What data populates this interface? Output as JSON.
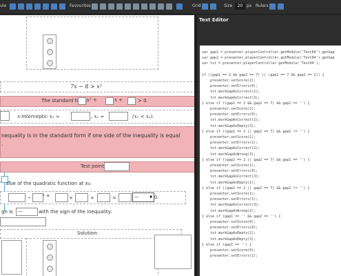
{
  "toolbar": {
    "favourites_label": "Favourites",
    "grid_label": "Grid",
    "size_label": "Size",
    "size_value": "20",
    "size_unit": "px",
    "rulers_label": "Rulers",
    "left_fragment": "ule"
  },
  "canvas": {
    "equation": "7x − 8 > x²",
    "standard_form_label": "The standard form:",
    "standard_form_x2": "x² +",
    "standard_form_x": "x +",
    "standard_form_end": "> 0.",
    "intercepts_label": "x-intercepts: x₁ ≈",
    "intercepts_x2": ", x₂ ≈",
    "intercepts_cond": "(x₁ < x₂).",
    "hint_line1": "nequality is in the standard form if one side of the inequality is equal",
    "hint_line2": ".",
    "test_point_label": "Test point:",
    "value_label": "alue of the quadratic function at x₀:",
    "calc_minus": "−",
    "calc_sq": "²  +",
    "calc_times": "×",
    "calc_plus": "+",
    "calc_eq": "=",
    "select_value": "---",
    "select_end": "0.",
    "sign_prefix": "gn is",
    "sign_select": "---",
    "sign_suffix": "with the sign of the inequality:",
    "solution_label": "Solution:"
  },
  "editor": {
    "title": "Text Editor",
    "lines": [
      "var gap1 = presenter.playerController.getModule('Text04').getGap",
      "var gap2 = presenter.playerController.getModule('Text04').getGap",
      "var txt = presenter.playerController.getModule('Text04');",
      "",
      "if ((gap1 == 2 && gap2 == 7) || (gap1 == 7 && gap2 == 2)) {",
      "    presenter.setScore(2);",
      "    presenter.setErrors(0);",
      "    txt.markGapAsCorrect(2);",
      "    txt.markGapAsCorrect(3);",
      "} else if ((gap1 == 2 && gap2 == 7) && gap2 == '') {",
      "    presenter.setScore(1);",
      "    presenter.setErrors(0);",
      "    txt.markGapAsCorrect(2);",
      "    txt.markGapAsEmpty(3);",
      "} else if ((gap1 == 2 || gap2 == 7) && gap2 != '') {",
      "    presenter.setScore(1);",
      "    presenter.setErrors(1);",
      "    txt.markGapAsCorrect(2);",
      "    txt.markGapAsWrong(3);",
      "} else if ((gap2 == 2 || gap2 == 7) && gap1 == '') {",
      "    presenter.setScore(1);",
      "    presenter.setErrors(0);",
      "    txt.markGapAsCorrect(3);",
      "    txt.markGapAsEmpty(2);",
      "} else if ((gap2 == 2 || gap2 == 7) && gap1 != '') {",
      "    presenter.setScore(1);",
      "    presenter.setErrors(1);",
      "    txt.markGapAsCorrect(3);",
      "    txt.markGapAsWrong(2);",
      "} else if (gap1 == '' && gap2 == '') {",
      "    presenter.setScore(0);",
      "    presenter.setErrors(0);",
      "    txt.markGapAsEmpty(2);",
      "    txt.markGapAsEmpty(3);",
      "} else if (gap1 == '') {",
      "    presenter.setScore(0);",
      "    presenter.setErrors(1);"
    ]
  },
  "colors": {
    "pink": "#f1b3b7",
    "toolbar_icon": "#4a7fc0",
    "guide": "#57a3d6"
  }
}
